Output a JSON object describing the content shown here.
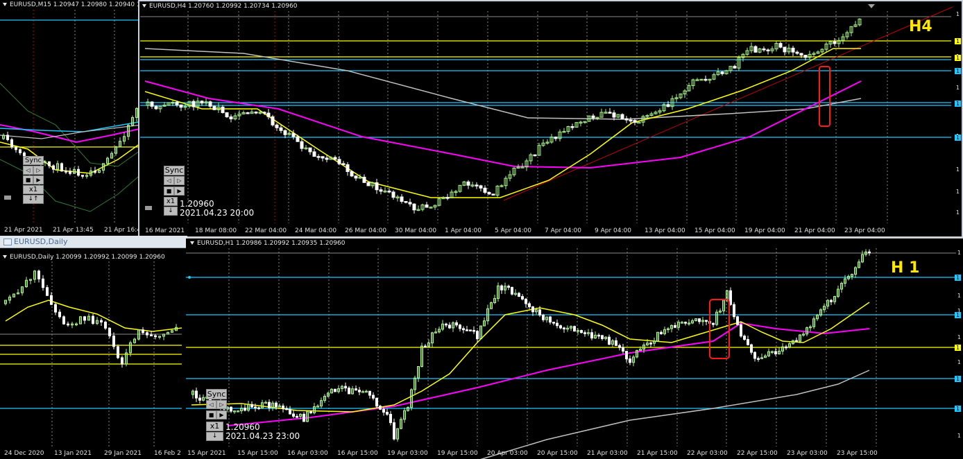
{
  "m15": {
    "header": "EURUSD,M15  1.20947 1.20980 1.20940 1",
    "xlabels": [
      "21 Apr 2021",
      "21 Apr 13:45",
      "21 Apr 16:4"
    ],
    "sync": {
      "label": "Sync",
      "mult": "x1"
    }
  },
  "h4": {
    "header": "EURUSD,H4  1.20760 1.20992 1.20734 1.20960",
    "tf_label": "H4",
    "price": "1.20960",
    "datetime": "2021.04.23 20:00",
    "sync": {
      "label": "Sync",
      "mult": "x1"
    },
    "xlabels": [
      "16 Mar 2021",
      "18 Mar 08:00",
      "22 Mar 04:00",
      "24 Mar 04:00",
      "26 Mar 04:00",
      "30 Mar 04:00",
      "1 Apr 04:00",
      "5 Apr 04:00",
      "7 Apr 04:00",
      "9 Apr 04:00",
      "13 Apr 04:00",
      "15 Apr 04:00",
      "19 Apr 04:00",
      "21 Apr 04:00",
      "23 Apr 04:00"
    ],
    "yticks": [
      "1",
      "1",
      "1",
      "1",
      "1",
      "1",
      "1",
      "1",
      "1",
      "1"
    ]
  },
  "daily": {
    "window_title": "EURUSD,Daily",
    "header": "EURUSD,Daily  1.20099 1.20992 1.20099 1.20960",
    "xlabels": [
      "24 Dec 2020",
      "13 Jan 2021",
      "29 Jan 2021",
      "16 Feb 2"
    ]
  },
  "h1": {
    "header": "EURUSD,H1  1.20986 1.20992 1.20935 1.20960",
    "tf_label": "H 1",
    "price": "1.20960",
    "datetime": "2021.04.23 23:00",
    "sync": {
      "label": "Sync",
      "mult": "x1"
    },
    "xlabels": [
      "15 Apr 2021",
      "15 Apr 15:00",
      "16 Apr 03:00",
      "16 Apr 15:00",
      "19 Apr 03:00",
      "19 Apr 15:00",
      "20 Apr 03:00",
      "20 Apr 15:00",
      "21 Apr 03:00",
      "21 Apr 15:00",
      "22 Apr 03:00",
      "22 Apr 15:00",
      "23 Apr 03:00",
      "23 Apr 15:00"
    ],
    "yticks": [
      "1",
      "1",
      "1",
      "1",
      "1",
      "1",
      "1",
      "1",
      "1",
      "1"
    ]
  },
  "colors": {
    "background": "#000000",
    "bull_candle": "#a8f58c",
    "bear_candle": "#ffffff",
    "ma_fast": "#ffff00",
    "ma_mid": "#ff00ff",
    "ma_slow": "#c0c0c0",
    "hline_blue": "#1ec8ff",
    "hline_yellow": "#ffff00",
    "trendline": "#c00000",
    "highlight_box": "#ff1a1a",
    "tf_label": "#ffe800",
    "grid": "#8a8a8a"
  }
}
